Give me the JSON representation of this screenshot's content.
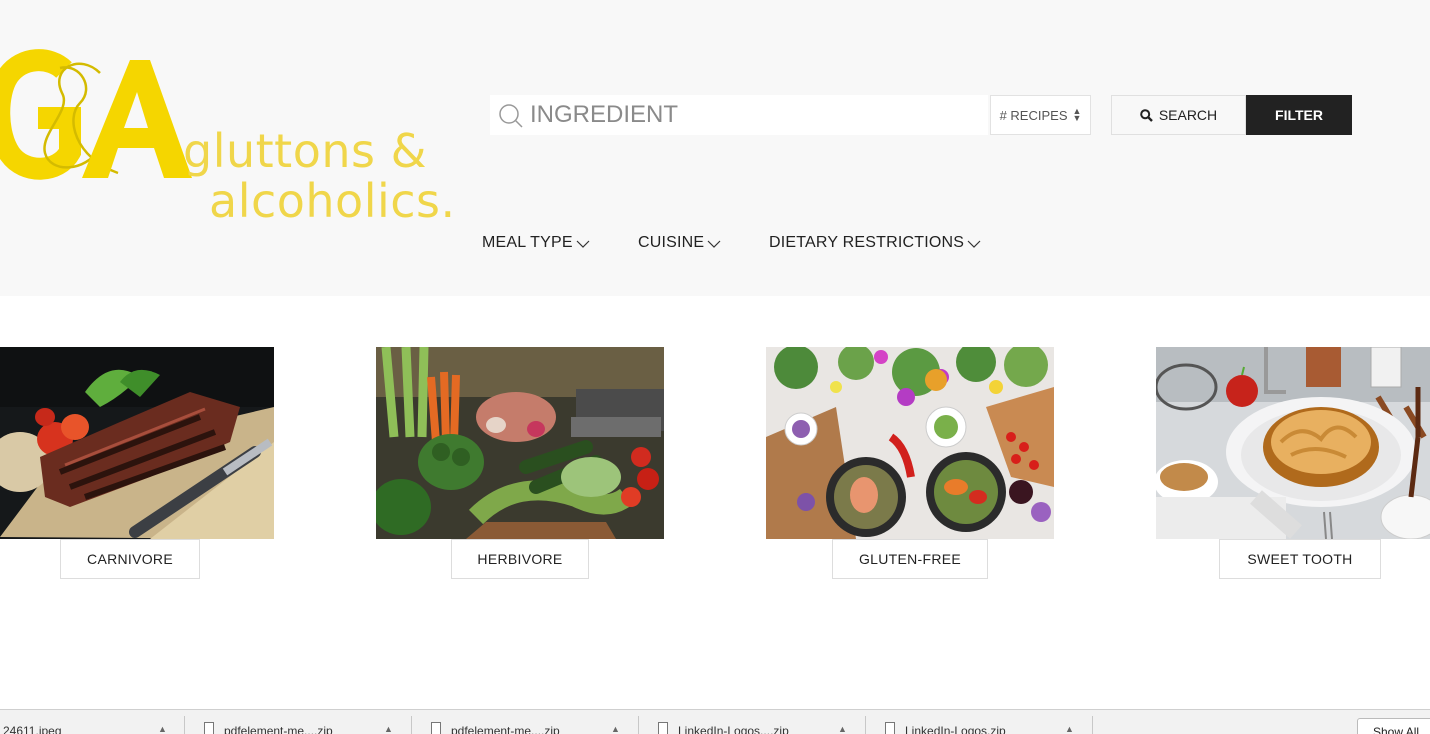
{
  "logo": {
    "monogram": "G&A",
    "line1": "gluttons &",
    "line2": "alcoholics.",
    "color": "#f5d600"
  },
  "search": {
    "placeholder": "INGREDIENT",
    "icon": "magnifier-icon"
  },
  "recipes_select": {
    "label": "# RECIPES",
    "icon": "updown-arrows-icon"
  },
  "buttons": {
    "search_label": "SEARCH",
    "filter_label": "FILTER",
    "search_icon": "search-icon"
  },
  "nav": {
    "items": [
      {
        "label": "MEAL TYPE"
      },
      {
        "label": "CUISINE"
      },
      {
        "label": "DIETARY RESTRICTIONS"
      }
    ]
  },
  "categories": [
    {
      "label": "CARNIVORE"
    },
    {
      "label": "HERBIVORE"
    },
    {
      "label": "GLUTEN-FREE"
    },
    {
      "label": "SWEET TOOTH"
    }
  ],
  "downloads": {
    "items": [
      {
        "name": "24611.jpeg"
      },
      {
        "name": "pdfelement-me....zip"
      },
      {
        "name": "pdfelement-me....zip"
      },
      {
        "name": "LinkedIn-Logos....zip"
      },
      {
        "name": "LinkedIn-Logos.zip"
      }
    ],
    "show_all": "Show All"
  }
}
